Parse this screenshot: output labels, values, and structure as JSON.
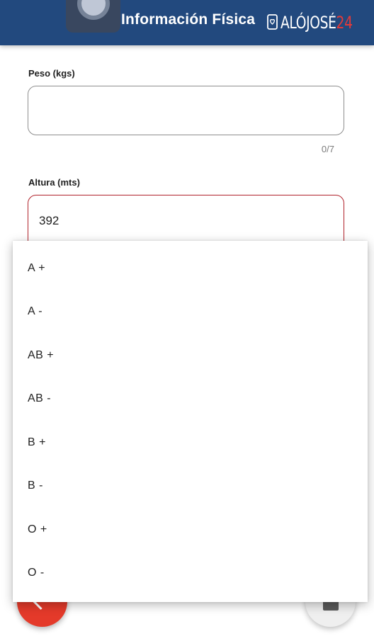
{
  "header": {
    "title": "Información Física",
    "brand_main": "ALÓJOSÉ",
    "brand_accent": "24",
    "color": "#22497e"
  },
  "form": {
    "weight": {
      "label": "Peso (kgs)",
      "value": "",
      "counter": "0/7"
    },
    "height": {
      "label": "Altura (mts)",
      "value": "392",
      "border_color": "#b0212a"
    }
  },
  "blood_type_dropdown": {
    "options": [
      "A +",
      "A -",
      "AB +",
      "AB -",
      "B +",
      "B -",
      "O +",
      "O -"
    ]
  },
  "actions": {
    "back_icon": "chevron-left-icon",
    "back_color": "#e43a2a",
    "camera_icon": "camera-icon"
  }
}
